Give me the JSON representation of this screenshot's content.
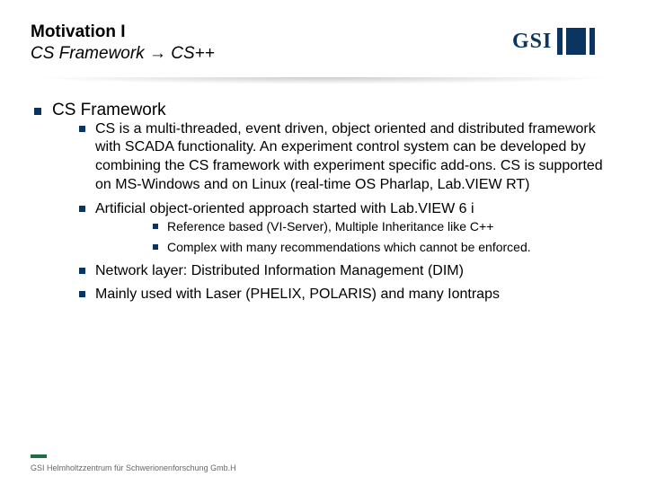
{
  "header": {
    "title": "Motivation I",
    "subtitle": "CS Framework → CS++"
  },
  "logo": {
    "text": "GSI"
  },
  "bullets": {
    "l1": "CS Framework",
    "l2a": "CS is a multi-threaded, event driven, object oriented and distributed framework with SCADA functionality. An experiment control system can be developed by combining the CS framework with experiment specific add-ons. CS is supported on MS-Windows and on Linux (real-time OS Pharlap, Lab.VIEW RT)",
    "l2b": "Artificial object-oriented approach started with Lab.VIEW 6 i",
    "l3a": "Reference based (VI-Server), Multiple Inheritance like C++",
    "l3b": "Complex with many recommendations which cannot be enforced.",
    "l2c": "Network layer: Distributed Information Management (DIM)",
    "l2d": "Mainly used with Laser (PHELIX, POLARIS) and many Iontraps"
  },
  "footer": "GSI Helmholtzzentrum für Schwerionenforschung Gmb.H"
}
